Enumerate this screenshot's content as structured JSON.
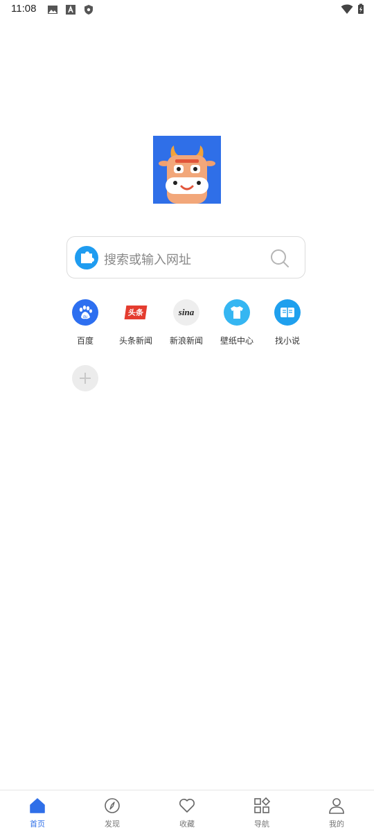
{
  "status_bar": {
    "time": "11:08"
  },
  "search": {
    "placeholder": "搜索或输入网址"
  },
  "shortcuts": [
    {
      "label": "百度",
      "icon": "baidu-icon"
    },
    {
      "label": "头条新闻",
      "icon": "toutiao-icon",
      "icon_text": "头条"
    },
    {
      "label": "新浪新闻",
      "icon": "sina-icon",
      "icon_text": "sina"
    },
    {
      "label": "壁纸中心",
      "icon": "tshirt-icon"
    },
    {
      "label": "找小说",
      "icon": "book-icon"
    }
  ],
  "bottom_nav": [
    {
      "label": "首页",
      "icon": "home-icon",
      "active": true
    },
    {
      "label": "发现",
      "icon": "compass-icon"
    },
    {
      "label": "收藏",
      "icon": "heart-icon"
    },
    {
      "label": "导航",
      "icon": "grid-icon"
    },
    {
      "label": "我的",
      "icon": "user-icon"
    }
  ],
  "colors": {
    "accent": "#2f6fe8",
    "logo_bg": "#2f6fe8"
  }
}
